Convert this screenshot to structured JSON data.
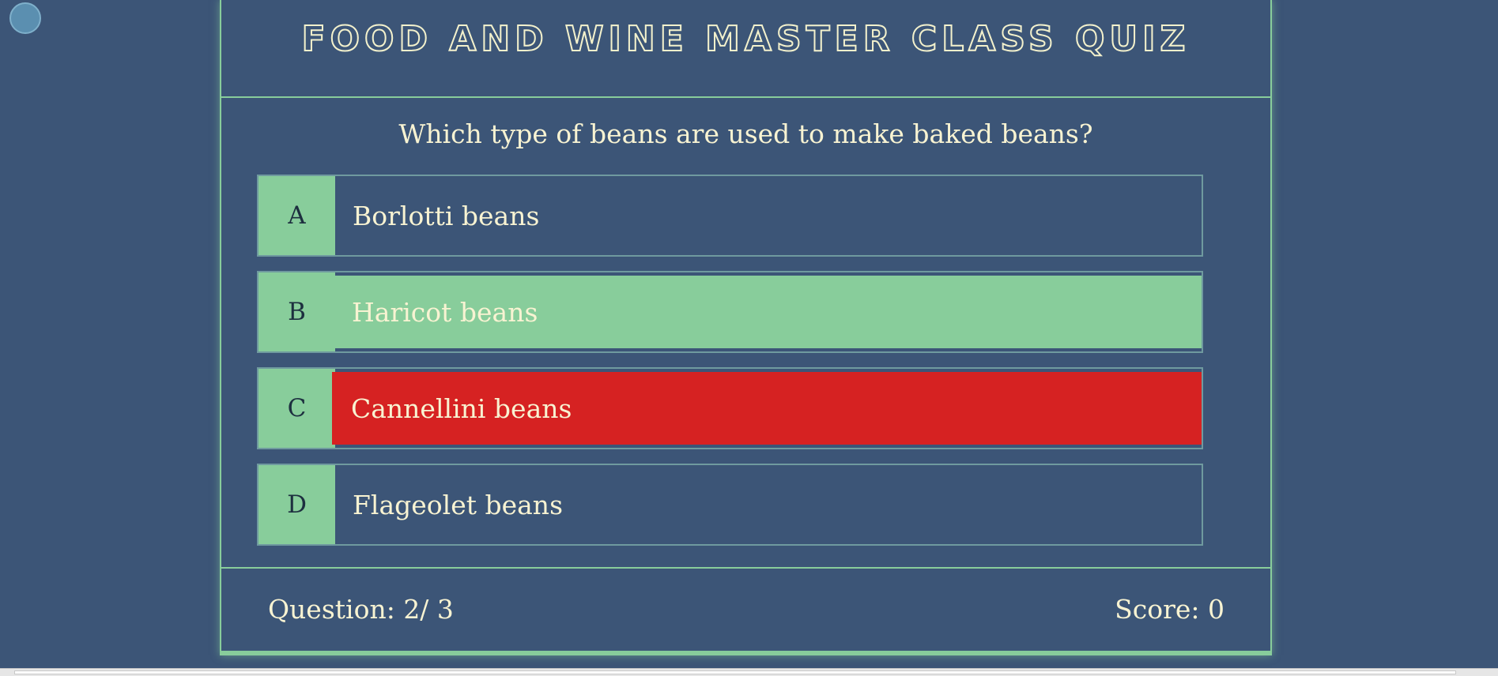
{
  "colors": {
    "page_background": "#3c5577",
    "accent_green": "#88cd9b",
    "wrong_red": "#d62222",
    "text_cream": "#f8f3d2",
    "letter_dark": "#1d2f3f"
  },
  "header": {
    "title": "Food and Wine Master Class Quiz"
  },
  "question": {
    "text": "Which type of beans are used to make baked beans?"
  },
  "answers": [
    {
      "letter": "A",
      "text": "Borlotti beans",
      "state": "default"
    },
    {
      "letter": "B",
      "text": "Haricot beans",
      "state": "correct"
    },
    {
      "letter": "C",
      "text": "Cannellini beans",
      "state": "incorrect"
    },
    {
      "letter": "D",
      "text": "Flageolet beans",
      "state": "default"
    }
  ],
  "footer": {
    "question_progress": "Question: 2/ 3",
    "score": "Score: 0"
  }
}
